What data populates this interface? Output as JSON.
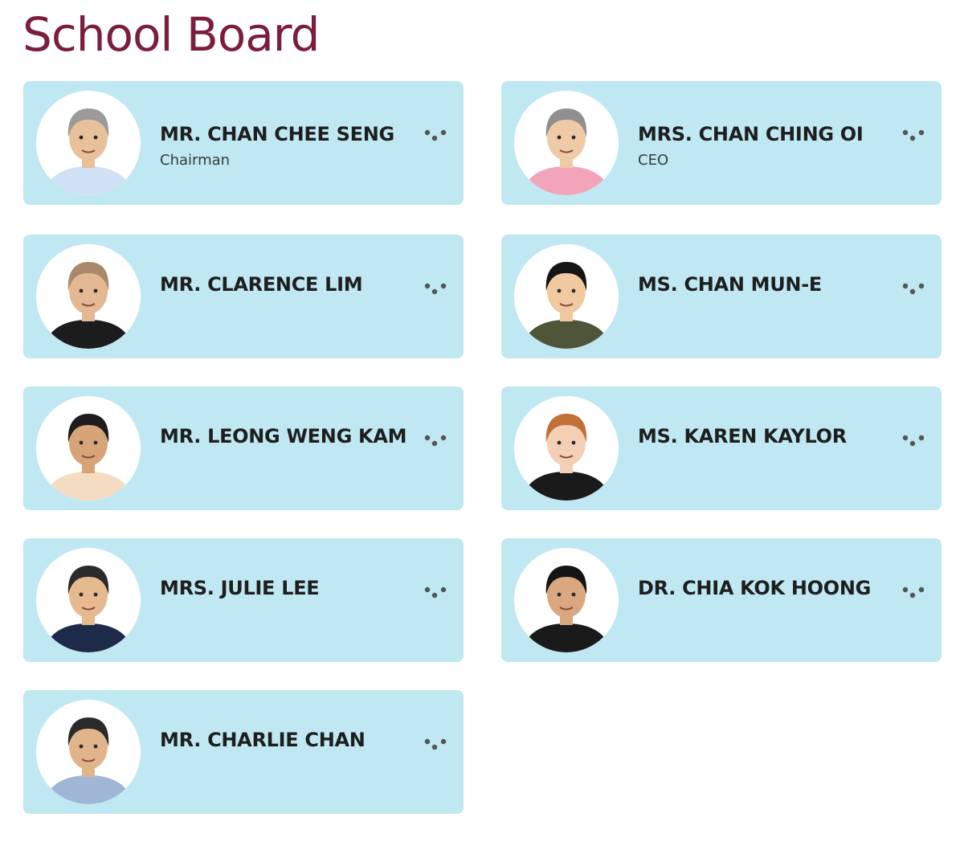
{
  "page": {
    "title": "School Board"
  },
  "members": [
    {
      "name": "MR. CHAN CHEE SENG",
      "role": "Chairman",
      "skin": "#e8c09a",
      "hair": "#9a9a9a",
      "shirt": "#cfe2f5"
    },
    {
      "name": "MRS. CHAN CHING OI",
      "role": "CEO",
      "skin": "#efcaa7",
      "hair": "#8f8f8f",
      "shirt": "#f2a5b8"
    },
    {
      "name": "MR. CLARENCE LIM",
      "role": "",
      "skin": "#e3b892",
      "hair": "#a88a6a",
      "shirt": "#1c1c1c"
    },
    {
      "name": "MS. CHAN MUN-E",
      "role": "",
      "skin": "#f0c9a0",
      "hair": "#151515",
      "shirt": "#4f5538"
    },
    {
      "name": "MR. LEONG WENG KAM",
      "role": "",
      "skin": "#d7a478",
      "hair": "#1d1d1d",
      "shirt": "#f4dcc0"
    },
    {
      "name": "MS. KAREN KAYLOR",
      "role": "",
      "skin": "#f3cfb5",
      "hair": "#c2703a",
      "shirt": "#1a1a1a"
    },
    {
      "name": "MRS. JULIE LEE",
      "role": "",
      "skin": "#e6b98f",
      "hair": "#2b2b2b",
      "shirt": "#1e2a4a"
    },
    {
      "name": "DR. CHIA KOK HOONG",
      "role": "",
      "skin": "#d9a880",
      "hair": "#151515",
      "shirt": "#1a1a1a"
    },
    {
      "name": "MR. CHARLIE CHAN",
      "role": "",
      "skin": "#e2b48c",
      "hair": "#2a2a2a",
      "shirt": "#9fb6d6"
    }
  ],
  "icons": {
    "avatar": "person-photo",
    "more": "three-dots-icon"
  },
  "colors": {
    "title": "#7c1d3f",
    "card_background": "#bfe8f2",
    "dots": "#555555"
  }
}
